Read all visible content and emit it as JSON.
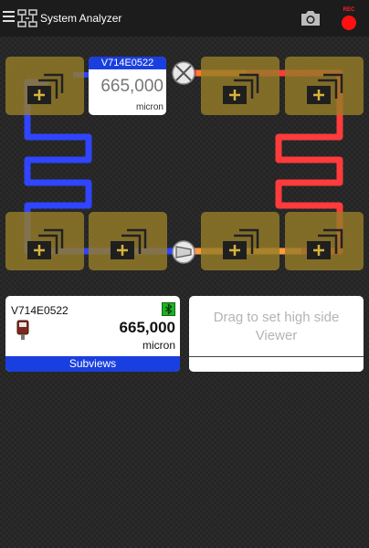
{
  "app": {
    "title": "System Analyzer"
  },
  "toolbar": {
    "rec_label": "REC"
  },
  "diagram": {
    "sensor_card": {
      "id": "V714E0522",
      "value": "665,000",
      "unit": "micron"
    }
  },
  "panels": {
    "left": {
      "id": "V714E0522",
      "value": "665,000",
      "unit": "micron",
      "tab_label": "Subviews"
    },
    "right": {
      "line1": "Drag to set high side",
      "line2": "Viewer"
    }
  },
  "colors": {
    "low_side": "#2f45ff",
    "high_side": "#ff3b3b",
    "accent": "#1a3fe0",
    "tile": "#967c28"
  }
}
